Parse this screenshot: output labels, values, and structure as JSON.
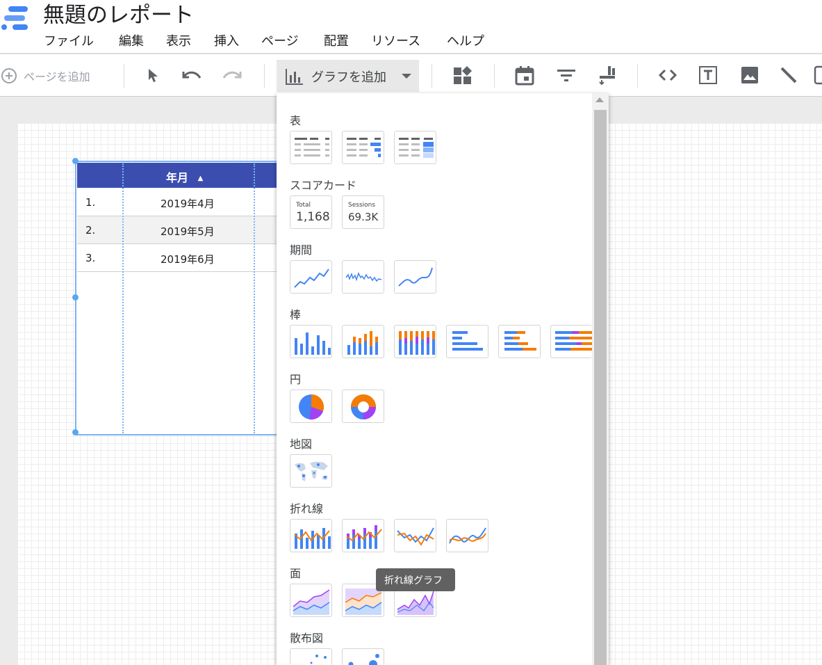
{
  "app": {
    "title": "無題のレポート"
  },
  "menu": [
    "ファイル",
    "編集",
    "表示",
    "挿入",
    "ページ",
    "配置",
    "リソース",
    "ヘルプ"
  ],
  "toolbar": {
    "add_page": "ページを追加",
    "add_chart": "グラフを追加"
  },
  "table": {
    "column_header": "年月",
    "sort_indicator": "▲",
    "rows": [
      {
        "index": "1.",
        "value": "2019年4月"
      },
      {
        "index": "2.",
        "value": "2019年5月"
      },
      {
        "index": "3.",
        "value": "2019年6月"
      }
    ]
  },
  "chart_menu": {
    "categories": [
      "表",
      "スコアカード",
      "期間",
      "棒",
      "円",
      "地図",
      "折れ線",
      "面",
      "散布図"
    ],
    "scorecards": [
      {
        "label": "Total",
        "value": "1,168"
      },
      {
        "label": "Sessions",
        "value": "69.3K"
      }
    ]
  },
  "tooltip": "折れ線グラフ",
  "colors": {
    "brand_blue": "#4285f4",
    "table_header": "#3b4eb0",
    "selection": "#7cb4f0",
    "orange": "#f57c00",
    "purple": "#a142f4"
  }
}
